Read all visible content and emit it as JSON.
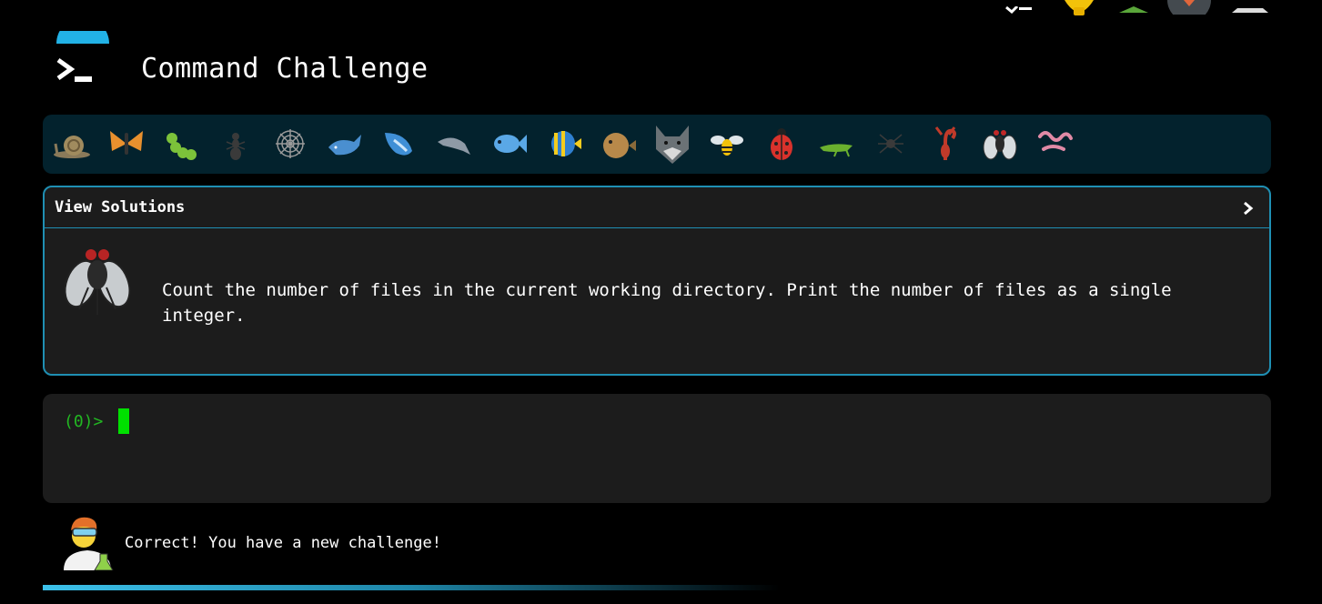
{
  "header": {
    "title": "Command Challenge",
    "logo_icon": "terminal-prompt-icon"
  },
  "top_icons": [
    "checklist-icon",
    "lightbulb-icon",
    "tree-icon",
    "avatar-circle-icon",
    "triangle-icon"
  ],
  "critters": [
    "snail-icon",
    "butterfly-icon",
    "caterpillar-icon",
    "ant-icon",
    "spider-web-icon",
    "whale-icon",
    "spouting-whale-icon",
    "dolphin-icon",
    "fish-icon",
    "tropical-fish-icon",
    "blowfish-icon",
    "wolf-icon",
    "bee-icon",
    "ladybug-icon",
    "cricket-icon",
    "spider-icon",
    "scorpion-icon",
    "fly-icon",
    "worm-icon"
  ],
  "panel": {
    "view_solutions_label": "View Solutions",
    "challenge_icon": "fly-icon",
    "challenge_text": "Count the number of files in the current working directory. Print the number of files as a single integer."
  },
  "terminal": {
    "prompt": "(0)>"
  },
  "status": {
    "message": "Correct! You have a new challenge!",
    "avatar_icon": "scientist-icon"
  },
  "progress": {
    "fraction": 0.6
  },
  "colors": {
    "background": "#000000",
    "accent": "#1f8fb3",
    "critter_bar": "#03222d",
    "panel": "#1c1c1c",
    "prompt": "#22b822",
    "cursor": "#00e000"
  }
}
